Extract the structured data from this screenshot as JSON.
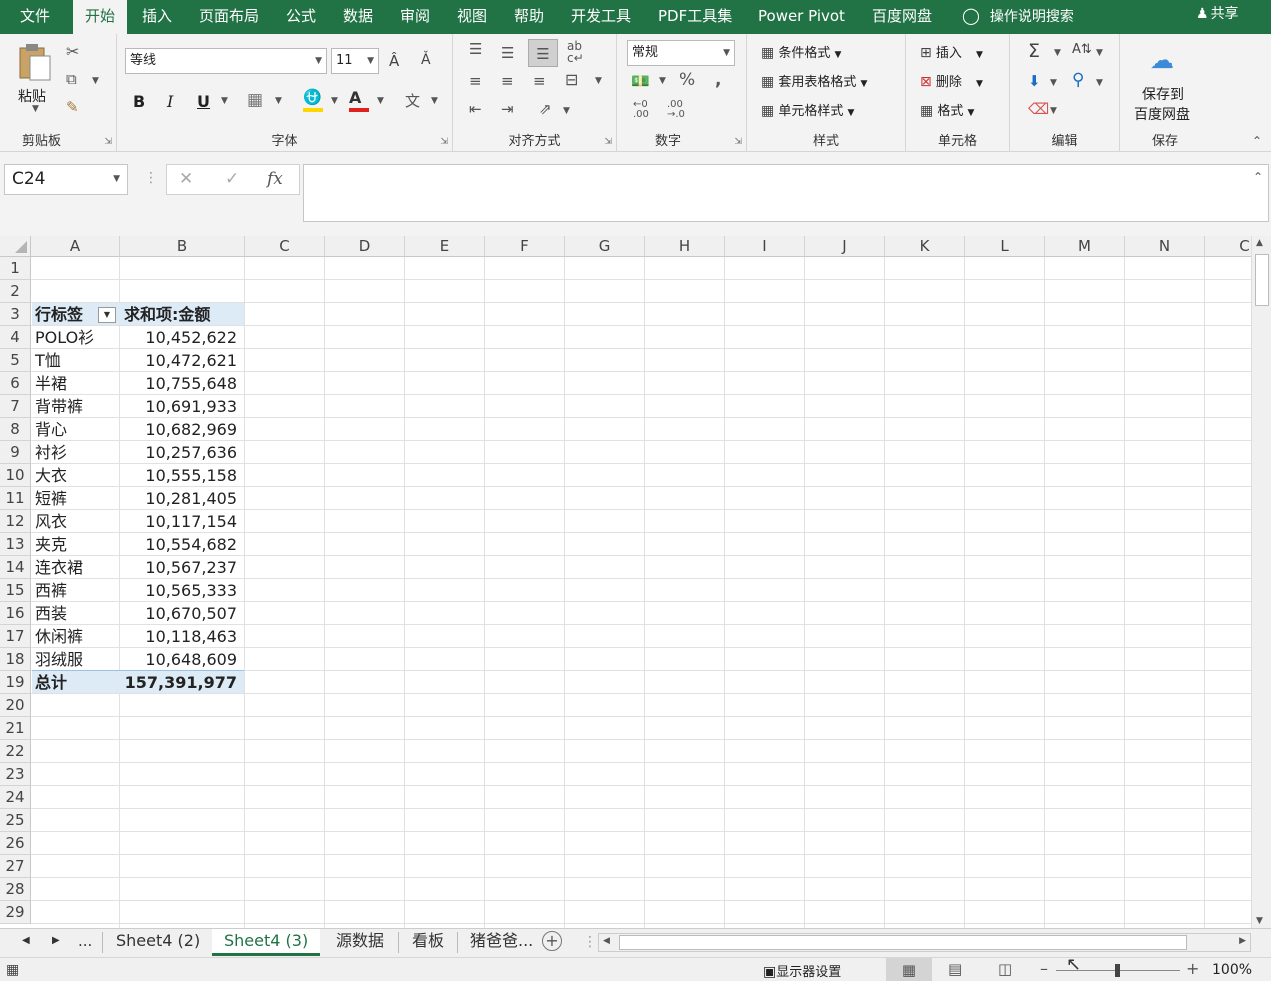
{
  "ribbon_tabs": [
    "文件",
    "开始",
    "插入",
    "页面布局",
    "公式",
    "数据",
    "审阅",
    "视图",
    "帮助",
    "开发工具",
    "PDF工具集",
    "Power Pivot",
    "百度网盘"
  ],
  "tell_me": "操作说明搜索",
  "share": "共享",
  "groups": {
    "clipboard": {
      "label": "剪贴板",
      "paste": "粘贴"
    },
    "font": {
      "label": "字体",
      "font_name": "等线",
      "font_size": "11",
      "bold": "B",
      "italic": "I",
      "underline": "U"
    },
    "alignment": {
      "label": "对齐方式"
    },
    "number": {
      "label": "数字",
      "format": "常规"
    },
    "styles": {
      "label": "样式",
      "conditional": "条件格式",
      "table_format": "套用表格格式",
      "cell_styles": "单元格样式"
    },
    "cells": {
      "label": "单元格",
      "insert": "插入",
      "delete": "删除",
      "format": "格式"
    },
    "editing": {
      "label": "编辑"
    },
    "save": {
      "label": "保存",
      "button_line1": "保存到",
      "button_line2": "百度网盘"
    }
  },
  "name_box": "C24",
  "formula_value": "",
  "columns": [
    "A",
    "B",
    "C",
    "D",
    "E",
    "F",
    "G",
    "H",
    "I",
    "J",
    "K",
    "L",
    "M",
    "N",
    "C"
  ],
  "rows": [
    "1",
    "2",
    "3",
    "4",
    "5",
    "6",
    "7",
    "8",
    "9",
    "10",
    "11",
    "12",
    "13",
    "14",
    "15",
    "16",
    "17",
    "18",
    "19",
    "20",
    "21",
    "22",
    "23",
    "24",
    "25",
    "26",
    "27",
    "28",
    "29"
  ],
  "pivot": {
    "header_label": "行标签",
    "header_value": "求和项:金额",
    "items": [
      {
        "label": "POLO衫",
        "value": "10,452,622"
      },
      {
        "label": "T恤",
        "value": "10,472,621"
      },
      {
        "label": "半裙",
        "value": "10,755,648"
      },
      {
        "label": "背带裤",
        "value": "10,691,933"
      },
      {
        "label": "背心",
        "value": "10,682,969"
      },
      {
        "label": "衬衫",
        "value": "10,257,636"
      },
      {
        "label": "大衣",
        "value": "10,555,158"
      },
      {
        "label": "短裤",
        "value": "10,281,405"
      },
      {
        "label": "风衣",
        "value": "10,117,154"
      },
      {
        "label": "夹克",
        "value": "10,554,682"
      },
      {
        "label": "连衣裙",
        "value": "10,567,237"
      },
      {
        "label": "西裤",
        "value": "10,565,333"
      },
      {
        "label": "西装",
        "value": "10,670,507"
      },
      {
        "label": "休闲裤",
        "value": "10,118,463"
      },
      {
        "label": "羽绒服",
        "value": "10,648,609"
      }
    ],
    "total_label": "总计",
    "total_value": "157,391,977"
  },
  "sheet_tabs": [
    "Sheet4 (2)",
    "Sheet4 (3)",
    "源数据",
    "看板",
    "猪爸爸..."
  ],
  "sheet_nav_more": "...",
  "status": {
    "display_settings": "显示器设置",
    "zoom": "100%"
  }
}
